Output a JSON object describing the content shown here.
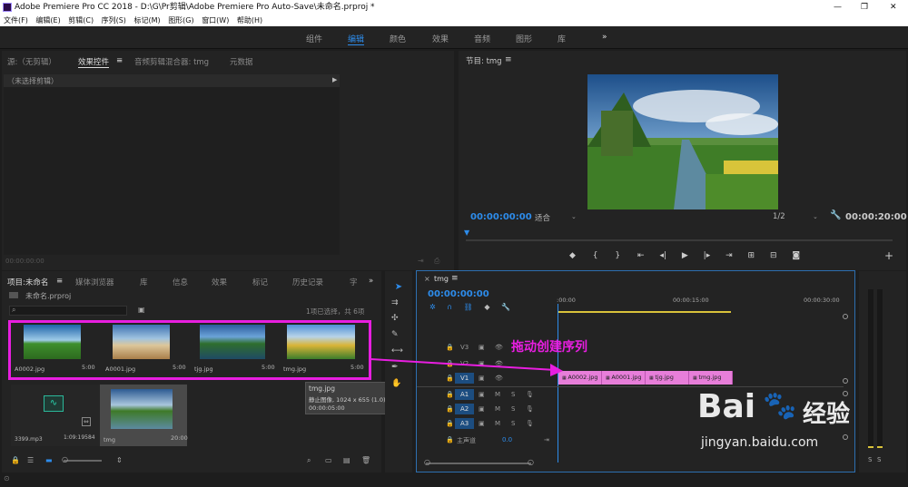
{
  "app": {
    "title": "Adobe Premiere Pro CC 2018 - D:\\G\\Pr剪辑\\Adobe Premiere Pro Auto-Save\\未命名.prproj *",
    "win_min": "—",
    "win_max": "❐",
    "win_close": "✕"
  },
  "menu": [
    "文件(F)",
    "编辑(E)",
    "剪辑(C)",
    "序列(S)",
    "标记(M)",
    "图形(G)",
    "窗口(W)",
    "帮助(H)"
  ],
  "workspaces": [
    "组件",
    "编辑",
    "颜色",
    "效果",
    "音频",
    "图形",
    "库"
  ],
  "ws_more": "»",
  "source_panel": {
    "tabs": [
      "源:（无剪辑）",
      "效果控件",
      "音频剪辑混合器: tmg",
      "元数据"
    ],
    "menu_icon": "≡",
    "subheader": "（未选择剪辑）",
    "timecode": "00:00:00:00"
  },
  "program": {
    "title": "节目: tmg",
    "menu_icon": "≡",
    "timecode_left": "00:00:00:00",
    "fit": "适合",
    "resolution": "1/2",
    "timecode_right": "00:00:20:00"
  },
  "project": {
    "tabs": [
      "项目:未命名",
      "媒体浏览器",
      "库",
      "信息",
      "效果",
      "标记",
      "历史记录",
      "字"
    ],
    "menu_icon": "≡",
    "bin": "未命名.prproj",
    "search_placeholder": "",
    "selection_info": "1项已选择，共 6项",
    "items": [
      {
        "name": "A0002.jpg",
        "dur": "5:00"
      },
      {
        "name": "A0001.jpg",
        "dur": "5:00"
      },
      {
        "name": "tjg.jpg",
        "dur": "5:00"
      },
      {
        "name": "tmg.jpg",
        "dur": "5:00"
      },
      {
        "name": "3399.mp3",
        "dur": "1:09:19584"
      },
      {
        "name": "tmg",
        "dur": "20:00"
      }
    ],
    "tooltip": {
      "name": "tmg.jpg",
      "info": "静止图像, 1024 x 655 (1.0)",
      "dur": "00:00:05:00"
    }
  },
  "annotation": "拖动创建序列",
  "timeline": {
    "tab": "tmg",
    "menu_icon": "≡",
    "timecode": "00:00:00:00",
    "ruler": [
      ":00:00",
      "00:00:15:00",
      "00:00:30:00"
    ],
    "tracks": [
      "V3",
      "V2",
      "V1",
      "A1",
      "A2",
      "A3"
    ],
    "master": "主声道",
    "master_val": "0.0",
    "clips": [
      "A0002.jpg",
      "A0001.jpg",
      "tjg.jpg",
      "tmg.jpg"
    ]
  },
  "watermark": {
    "brand": "Bai",
    "brand2": "经验",
    "url": "jingyan.baidu.com"
  },
  "meter": {
    "labels": [
      "S",
      "S"
    ]
  },
  "colors": {
    "accent": "#2d8ceb",
    "clip": "#e77ed9",
    "annotation": "#e81ee0"
  }
}
